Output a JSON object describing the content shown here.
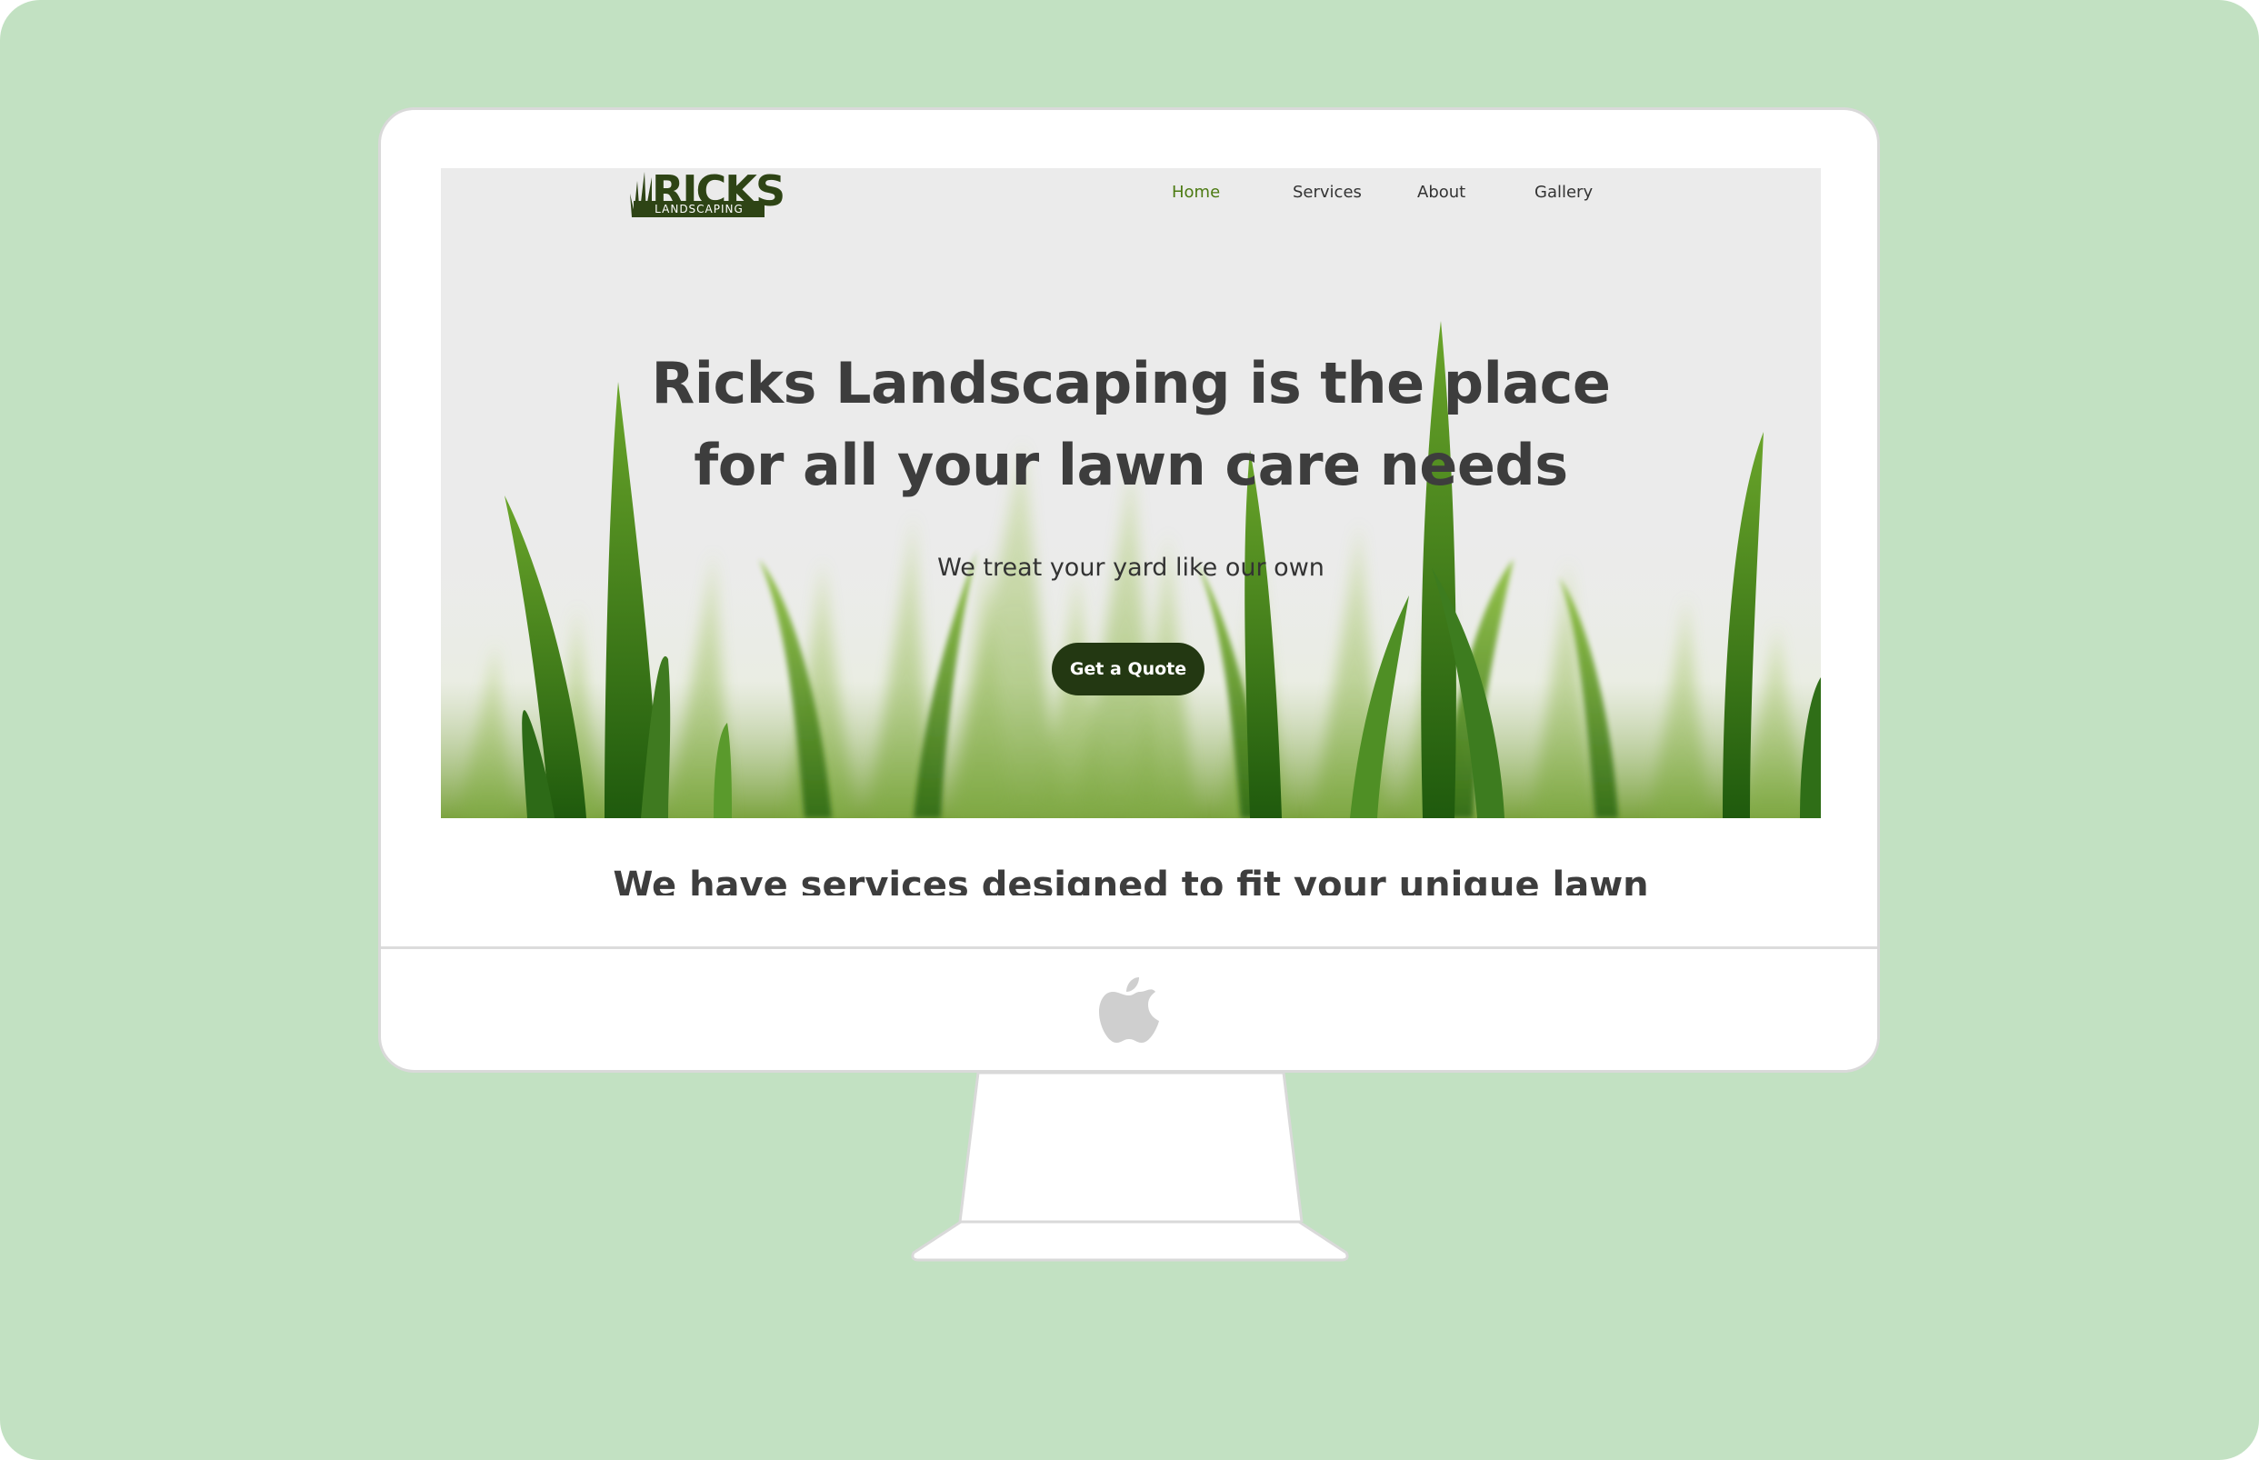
{
  "site": {
    "logo_text": "RICKS",
    "logo_subtext": "LANDSCAPING"
  },
  "nav": {
    "items": [
      {
        "label": "Home",
        "active": true
      },
      {
        "label": "Services",
        "active": false
      },
      {
        "label": "About",
        "active": false
      },
      {
        "label": "Gallery",
        "active": false
      }
    ]
  },
  "hero": {
    "headline_line1": "Ricks Landscaping is the place",
    "headline_line2": "for all your lawn care needs",
    "subheadline": "We treat your yard like our own",
    "cta_label": "Get a Quote"
  },
  "services": {
    "heading": "We have services designed to fit your unique lawn"
  },
  "colors": {
    "page_background": "#c2e1c2",
    "brand_dark_green": "#233812",
    "nav_active": "#4c7a12",
    "text_dark": "#3d3d3d",
    "hero_background": "#ebebeb"
  },
  "icons": {
    "device": "imac-monitor",
    "brand_mark": "apple-logo-icon",
    "logo_mark": "grass-icon"
  }
}
